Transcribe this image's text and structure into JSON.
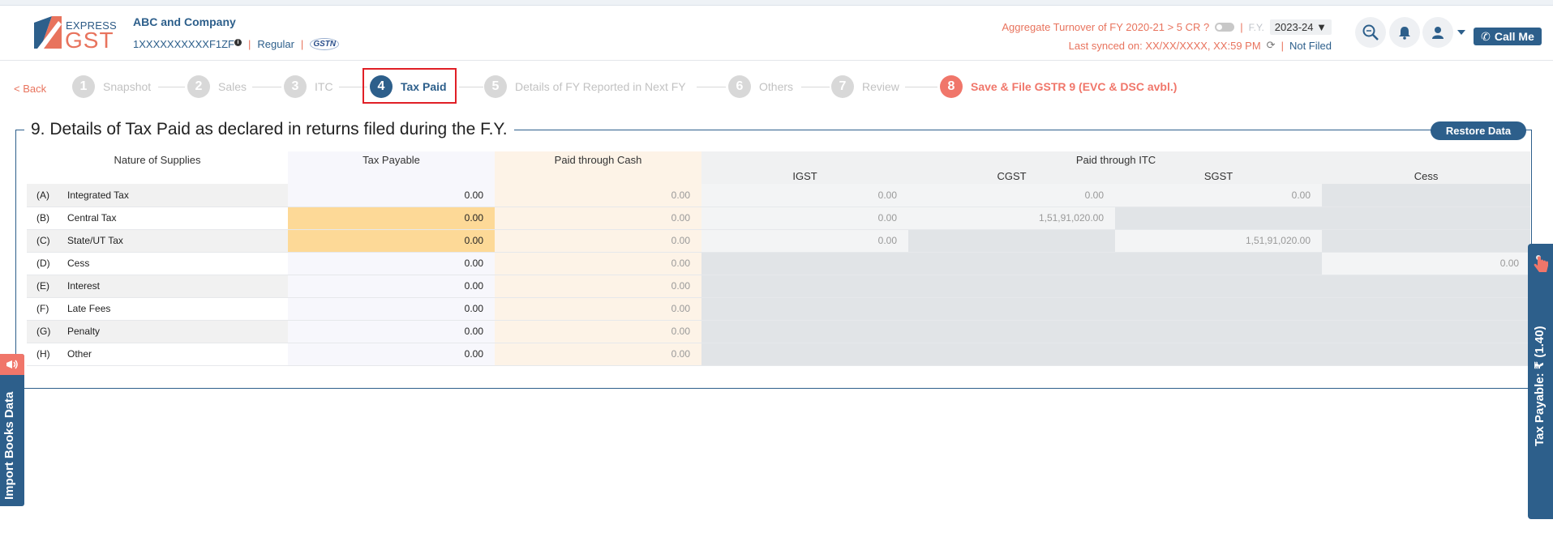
{
  "app": {
    "logo_top": "EXPRESS",
    "logo_bottom": "GST",
    "company_name": "ABC and Company",
    "gstin": "1XXXXXXXXXXF1ZF",
    "info_icon": "i",
    "separator": "|",
    "registration_type": "Regular",
    "gstn_badge": "GSTN"
  },
  "header": {
    "turnover_text": "Aggregate Turnover of FY 2020-21 > 5 CR ?",
    "fy_label": "F.Y.",
    "fy_value": "2023-24",
    "fy_caret": "▼",
    "last_synced": "Last synced on: XX/XX/XXXX, XX:59 PM",
    "refresh_icon": "⟳",
    "filing_status": "Not Filed",
    "call_me": "Call Me",
    "phone_icon": "✆"
  },
  "stepper": {
    "back_label": "< Back",
    "steps": [
      {
        "num": "1",
        "label": "Snapshot"
      },
      {
        "num": "2",
        "label": "Sales"
      },
      {
        "num": "3",
        "label": "ITC"
      },
      {
        "num": "4",
        "label": "Tax Paid"
      },
      {
        "num": "5",
        "label": "Details of FY Reported in Next FY"
      },
      {
        "num": "6",
        "label": "Others"
      },
      {
        "num": "7",
        "label": "Review"
      },
      {
        "num": "8",
        "label": "Save & File GSTR 9 (EVC & DSC avbl.)"
      }
    ]
  },
  "section": {
    "title": "9. Details of Tax Paid as declared in returns filed during the F.Y.",
    "restore_label": "Restore Data"
  },
  "table": {
    "headers": {
      "nature": "Nature of Supplies",
      "tax_payable": "Tax Payable",
      "paid_cash": "Paid through Cash",
      "paid_itc": "Paid through ITC",
      "igst": "IGST",
      "cgst": "CGST",
      "sgst": "SGST",
      "cess": "Cess"
    },
    "rows": [
      {
        "code": "(A)",
        "name": "Integrated Tax",
        "payable": "0.00",
        "cash": "0.00",
        "igst": "0.00",
        "cgst": "0.00",
        "sgst": "0.00",
        "cess": ""
      },
      {
        "code": "(B)",
        "name": "Central Tax",
        "payable": "0.00",
        "cash": "0.00",
        "igst": "0.00",
        "cgst": "1,51,91,020.00",
        "sgst": "",
        "cess": ""
      },
      {
        "code": "(C)",
        "name": "State/UT Tax",
        "payable": "0.00",
        "cash": "0.00",
        "igst": "0.00",
        "cgst": "",
        "sgst": "1,51,91,020.00",
        "cess": ""
      },
      {
        "code": "(D)",
        "name": "Cess",
        "payable": "0.00",
        "cash": "0.00",
        "igst": "",
        "cgst": "",
        "sgst": "",
        "cess": "0.00"
      },
      {
        "code": "(E)",
        "name": "Interest",
        "payable": "0.00",
        "cash": "0.00"
      },
      {
        "code": "(F)",
        "name": "Late Fees",
        "payable": "0.00",
        "cash": "0.00"
      },
      {
        "code": "(G)",
        "name": "Penalty",
        "payable": "0.00",
        "cash": "0.00"
      },
      {
        "code": "(H)",
        "name": "Other",
        "payable": "0.00",
        "cash": "0.00"
      }
    ]
  },
  "side_tabs": {
    "import_label": "Import Books Data",
    "tax_payable_label": "Tax Payable: ₹ (1.40)"
  },
  "colors": {
    "primary": "#2d5f8b",
    "accent": "#f0766a",
    "highlight": "#fdd997",
    "active_box": "#e01f26"
  }
}
